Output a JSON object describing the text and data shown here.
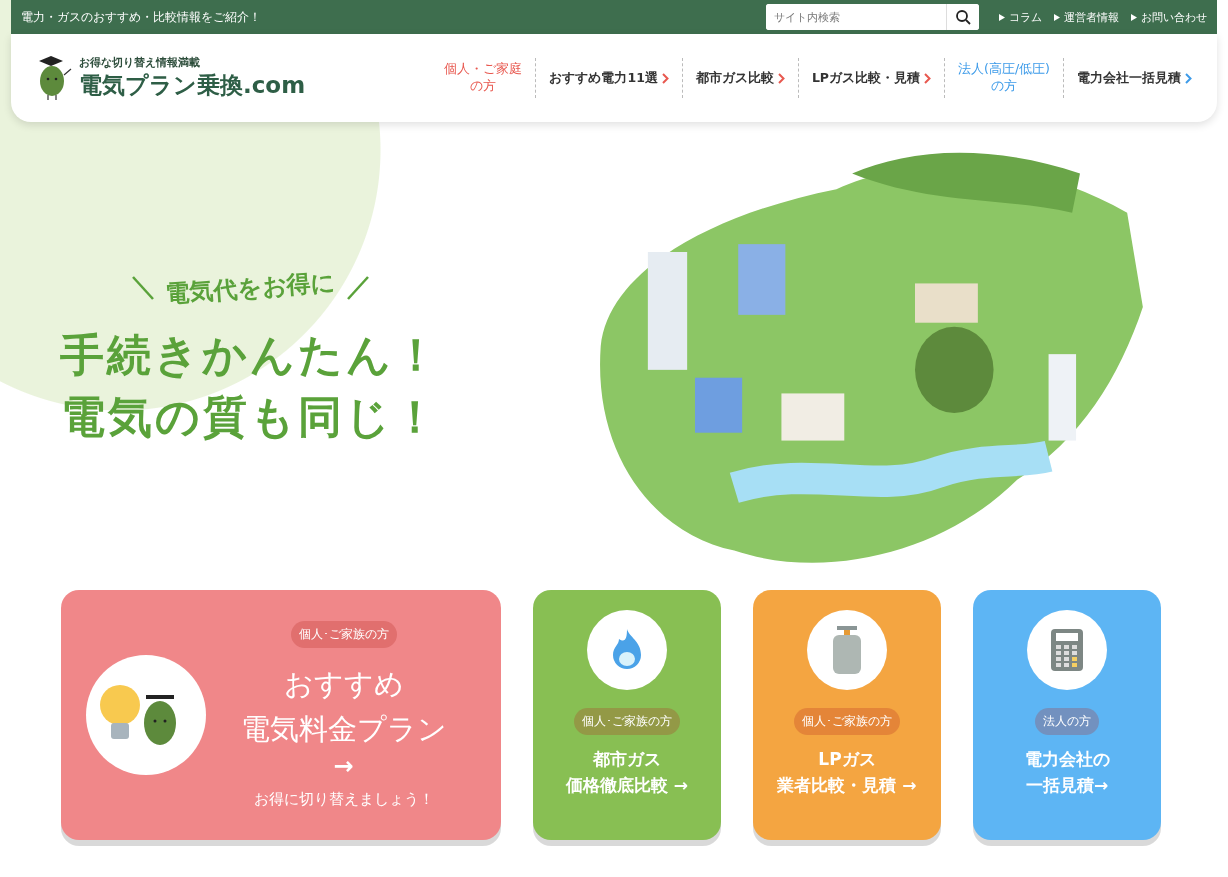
{
  "top_bar": {
    "tagline": "電力・ガスのおすすめ・比較情報をご紹介！",
    "search": {
      "placeholder": "サイト内検索"
    },
    "links": [
      "コラム",
      "運営者情報",
      "お問い合わせ"
    ]
  },
  "header": {
    "logo": {
      "subtitle": "お得な切り替え情報満載",
      "title": "電気プラン乗換",
      "suffix": ".com"
    },
    "nav": [
      {
        "label": [
          "個人・ご家庭",
          "の方"
        ],
        "kind": "audience",
        "color": "#e8584f"
      },
      {
        "label": [
          "おすすめ電力11選"
        ],
        "kind": "link",
        "color": "#e8584f"
      },
      {
        "label": [
          "都市ガス比較"
        ],
        "kind": "link",
        "color": "#e8584f"
      },
      {
        "label": [
          "LPガス比較・見積"
        ],
        "kind": "link",
        "color": "#e8584f"
      },
      {
        "label": [
          "法人(高圧/低圧)",
          "の方"
        ],
        "kind": "audience",
        "color": "#3d9be9"
      },
      {
        "label": [
          "電力会社一括見積"
        ],
        "kind": "link",
        "color": "#3d9be9"
      }
    ]
  },
  "hero": {
    "tagline": "電気代をお得に",
    "headline": [
      "手続きかんたん！",
      "電気の質も同じ！"
    ]
  },
  "cards": [
    {
      "kind": "large",
      "color": "#f08789",
      "badge": "個人･ご家族の方",
      "title": [
        "おすすめ",
        "電気料金プラン"
      ],
      "arrow": "→",
      "note": "お得に切り替えましょう！"
    },
    {
      "kind": "small",
      "color": "#88bf53",
      "badge": "個人･ご家族の方",
      "title": [
        "都市ガス",
        "価格徹底比較 →"
      ]
    },
    {
      "kind": "small",
      "color": "#f4a541",
      "badge": "個人･ご家族の方",
      "title": [
        "LPガス",
        "業者比較・見積 →"
      ]
    },
    {
      "kind": "small",
      "color": "#5db5f4",
      "badge": "法人の方",
      "title": [
        "電力会社の",
        "一括見積→"
      ]
    }
  ]
}
